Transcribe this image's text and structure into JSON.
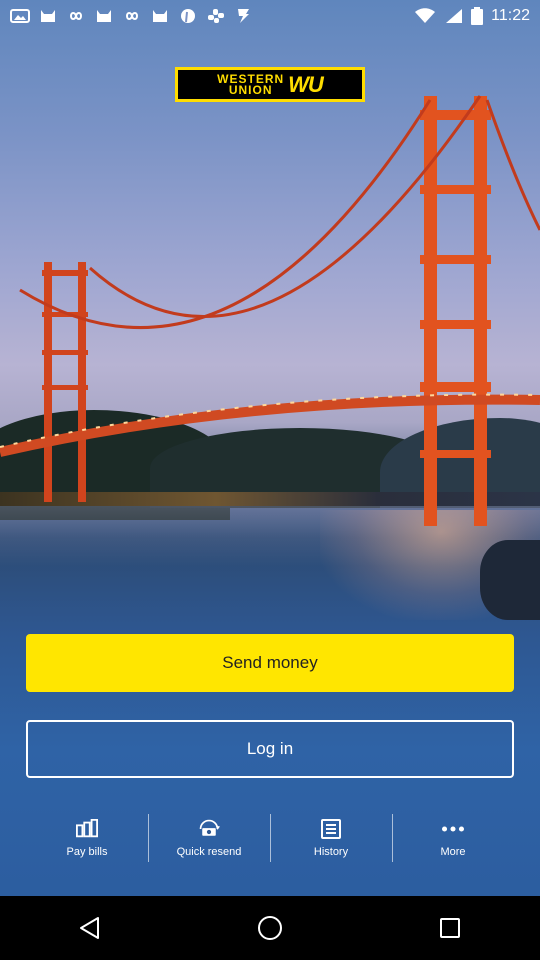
{
  "status_bar": {
    "time": "11:22",
    "icons": [
      "gallery-icon",
      "cat-icon",
      "infinity-icon",
      "cat-icon",
      "infinity-icon",
      "cat-icon",
      "pinterest-icon",
      "slack-icon",
      "flash-icon",
      "wifi-icon",
      "signal-icon",
      "battery-icon"
    ]
  },
  "brand": {
    "line1": "WESTERN",
    "line2": "UNION",
    "mark": "WU",
    "color": "#ffdd00"
  },
  "actions": {
    "send_money": "Send money",
    "log_in": "Log in"
  },
  "quick_nav": [
    {
      "label": "Pay bills",
      "icon": "bills-icon"
    },
    {
      "label": "Quick resend",
      "icon": "money-resend-icon"
    },
    {
      "label": "History",
      "icon": "history-icon"
    },
    {
      "label": "More",
      "icon": "more-dots-icon"
    }
  ],
  "system_nav": {
    "back": "back-icon",
    "home": "home-icon",
    "recents": "recents-icon"
  },
  "colors": {
    "accent": "#ffe600"
  }
}
